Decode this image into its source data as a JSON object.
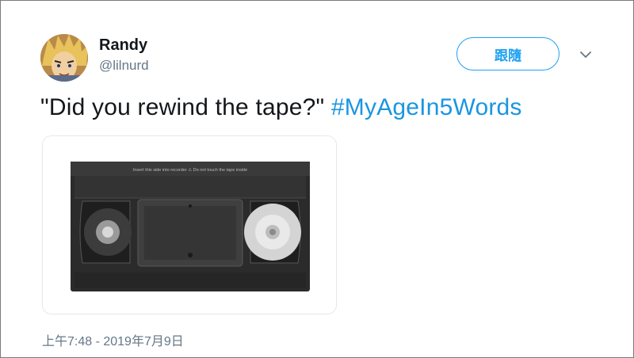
{
  "author": {
    "display_name": "Randy",
    "handle": "@lilnurd"
  },
  "follow_button": {
    "label": "跟隨"
  },
  "tweet": {
    "text": "\"Did you rewind the tape?\" ",
    "hashtag": "#MyAgeIn5Words"
  },
  "media": {
    "icon": "vhs-tape-icon",
    "label_text": "Insert this side into recorder  ⚠  Do not touch the tape inside"
  },
  "timestamp": "上午7:48 - 2019年7月9日",
  "colors": {
    "accent": "#1da1f2",
    "hashtag": "#1b95e0",
    "secondary_text": "#657786"
  }
}
